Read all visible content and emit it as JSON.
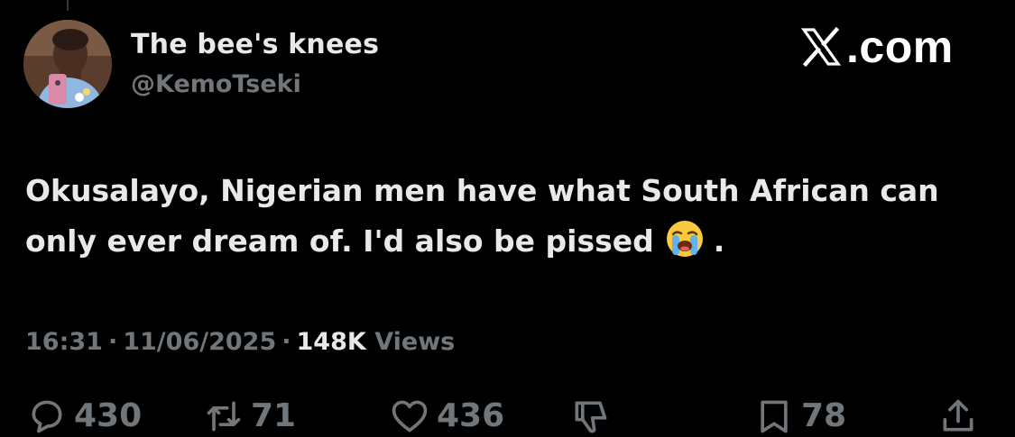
{
  "tweet": {
    "author": {
      "name": "The bee's knees",
      "handle": "@KemoTseki"
    },
    "brand": {
      "label": ".com",
      "logo_icon": "x-logo-icon"
    },
    "text": {
      "line1": "Okusalayo, Nigerian men have what South African can",
      "line2_before_emoji": "only ever dream of. I'd also be pissed",
      "emoji": "loudly-crying-face-emoji",
      "line2_after_emoji": "."
    },
    "meta": {
      "time": "16:31",
      "date": "11/06/2025",
      "views_count": "148K",
      "views_label": "Views",
      "separator": "·"
    },
    "actions": {
      "replies": "430",
      "reposts": "71",
      "likes": "436",
      "bookmarks": "78"
    },
    "colors": {
      "background": "#000000",
      "primary_text": "#e7e9ea",
      "secondary_text": "#71767b"
    }
  }
}
